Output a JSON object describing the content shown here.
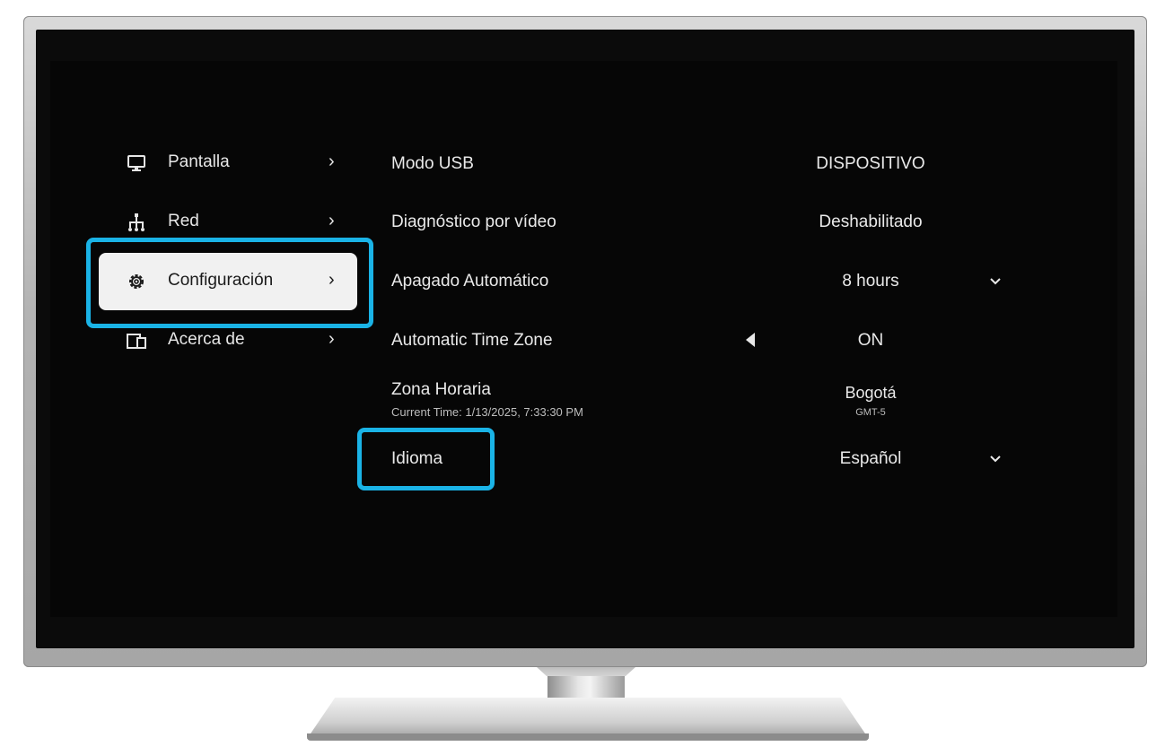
{
  "nav": {
    "items": [
      {
        "label": "Pantalla",
        "icon": "monitor-icon",
        "chevron": "›"
      },
      {
        "label": "Red",
        "icon": "network-icon",
        "chevron": "›"
      },
      {
        "label": "Configuración",
        "icon": "gear-icon",
        "chevron": "›",
        "selected": true
      },
      {
        "label": "Acerca de",
        "icon": "devices-icon",
        "chevron": "›"
      }
    ]
  },
  "settings": {
    "rows": [
      {
        "label": "Modo USB",
        "value": "DISPOSITIVO"
      },
      {
        "label": "Diagnóstico por vídeo",
        "value": "Deshabilitado"
      },
      {
        "label": "Apagado Automático",
        "value": "8 hours",
        "control": "chevron-down-icon"
      },
      {
        "label": "Automatic Time Zone",
        "value": "ON",
        "control": "caret-left-icon"
      },
      {
        "label": "Zona Horaria",
        "sublabel": "Current Time: 1/13/2025, 7:33:30 PM",
        "value": "Bogotá",
        "subvalue": "GMT-5"
      },
      {
        "label": "Idioma",
        "value": "Español",
        "control": "chevron-down-icon"
      }
    ]
  },
  "colors": {
    "highlight": "#1ab3e6",
    "screen_bg": "#060606",
    "selected_bg": "#f1f1f1",
    "text": "#e9e9e9"
  }
}
